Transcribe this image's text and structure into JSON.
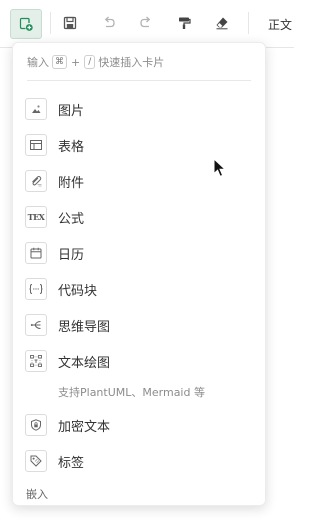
{
  "toolbar": {
    "buttons": [
      {
        "name": "insert-card",
        "icon": "insert-card-icon"
      },
      {
        "name": "save",
        "icon": "save-icon"
      },
      {
        "name": "undo",
        "icon": "undo-icon"
      },
      {
        "name": "redo",
        "icon": "redo-icon"
      },
      {
        "name": "format-painter",
        "icon": "paint-roller-icon"
      },
      {
        "name": "clear-format",
        "icon": "eraser-icon"
      }
    ],
    "style_select": "正文"
  },
  "insert_menu": {
    "hint": {
      "prefix": "输入",
      "key1": "⌘",
      "plus": "+",
      "key2": "/",
      "suffix": "快速插入卡片"
    },
    "items": [
      {
        "label": "图片",
        "icon": "image-icon"
      },
      {
        "label": "表格",
        "icon": "table-icon"
      },
      {
        "label": "附件",
        "icon": "attachment-icon"
      },
      {
        "label": "公式",
        "icon": "tex-icon",
        "icon_text": "TEX"
      },
      {
        "label": "日历",
        "icon": "calendar-icon"
      },
      {
        "label": "代码块",
        "icon": "code-block-icon",
        "icon_text": "{···}"
      },
      {
        "label": "思维导图",
        "icon": "mind-map-icon"
      },
      {
        "label": "文本绘图",
        "icon": "text-drawing-icon"
      },
      {
        "label": "加密文本",
        "icon": "encrypted-text-icon"
      },
      {
        "label": "标签",
        "icon": "tag-icon"
      }
    ],
    "text_drawing_note": "支持PlantUML、Mermaid 等",
    "embed_section_title": "嵌入"
  },
  "colors": {
    "accent": "#1e8e5a",
    "icon_gray": "#666666",
    "text": "#333333",
    "muted": "#8c8c8c"
  }
}
